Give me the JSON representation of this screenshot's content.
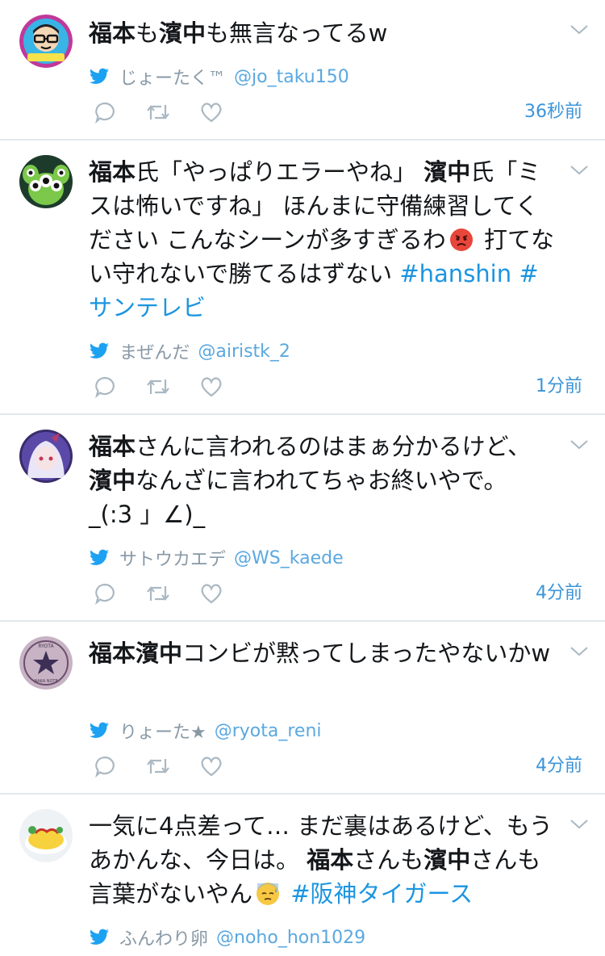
{
  "tweets": [
    {
      "segments": [
        {
          "t": "福本",
          "b": true
        },
        {
          "t": "も"
        },
        {
          "t": "濱中",
          "b": true
        },
        {
          "t": "も無言なってるw"
        }
      ],
      "author_name": "じょーたく™",
      "author_handle": "@jo_taku150",
      "time": "36秒前",
      "avatar_icon": "glasses-man-avatar"
    },
    {
      "segments": [
        {
          "t": "福本",
          "b": true
        },
        {
          "t": "氏「やっぱりエラーやね」 "
        },
        {
          "t": "濱中",
          "b": true
        },
        {
          "t": "氏「ミスは怖いですね」 ほんまに守備練習してください こんなシーンが多すぎるわ"
        },
        {
          "emoji": "angry"
        },
        {
          "t": " 打てない守れないで勝てるはずない "
        },
        {
          "t": "#hanshin",
          "tag": true
        },
        {
          "t": " "
        },
        {
          "t": "#サンテレビ",
          "tag": true
        }
      ],
      "author_name": "まぜんだ",
      "author_handle": "@airistk_2",
      "time": "1分前",
      "avatar_icon": "alien-avatar"
    },
    {
      "segments": [
        {
          "t": "福本",
          "b": true
        },
        {
          "t": "さんに言われるのはまぁ分かるけど、"
        },
        {
          "br": true
        },
        {
          "t": "濱中",
          "b": true
        },
        {
          "t": "なんざに言われてちゃお終いやで。"
        },
        {
          "br": true
        },
        {
          "t": "_(:3 」∠)_"
        }
      ],
      "author_name": "サトウカエデ",
      "author_handle": "@WS_kaede",
      "time": "4分前",
      "avatar_icon": "anime-girl-avatar"
    },
    {
      "segments": [
        {
          "t": "福本濱中",
          "b": true
        },
        {
          "t": "コンビが黙ってしまったやないかw"
        }
      ],
      "author_name": "りょーた★",
      "author_handle": "@ryota_reni",
      "time": "4分前",
      "avatar_icon": "star-badge-avatar",
      "avatar_text_top": "RYOTA",
      "avatar_text_bottom": "NAKA NOTE"
    },
    {
      "segments": [
        {
          "t": "一気に4点差って… まだ裏はあるけど、もうあかんな、今日は。 "
        },
        {
          "t": "福本",
          "b": true
        },
        {
          "t": "さんも"
        },
        {
          "t": "濱中",
          "b": true
        },
        {
          "t": "さんも言葉がないやん"
        },
        {
          "emoji": "sweat"
        },
        {
          "t": " "
        },
        {
          "t": "#阪神タイガース",
          "tag": true
        }
      ],
      "author_name": "ふんわり卵",
      "author_handle": "@noho_hon1029",
      "time": "",
      "avatar_icon": "omelette-avatar"
    }
  ],
  "colors": {
    "divider": "#e1e8ed",
    "text": "#14171a",
    "link": "#1b95e0",
    "muted": "#8899a6",
    "twitter_blue": "#1da1f2",
    "icon_gray": "#aab8c2"
  }
}
